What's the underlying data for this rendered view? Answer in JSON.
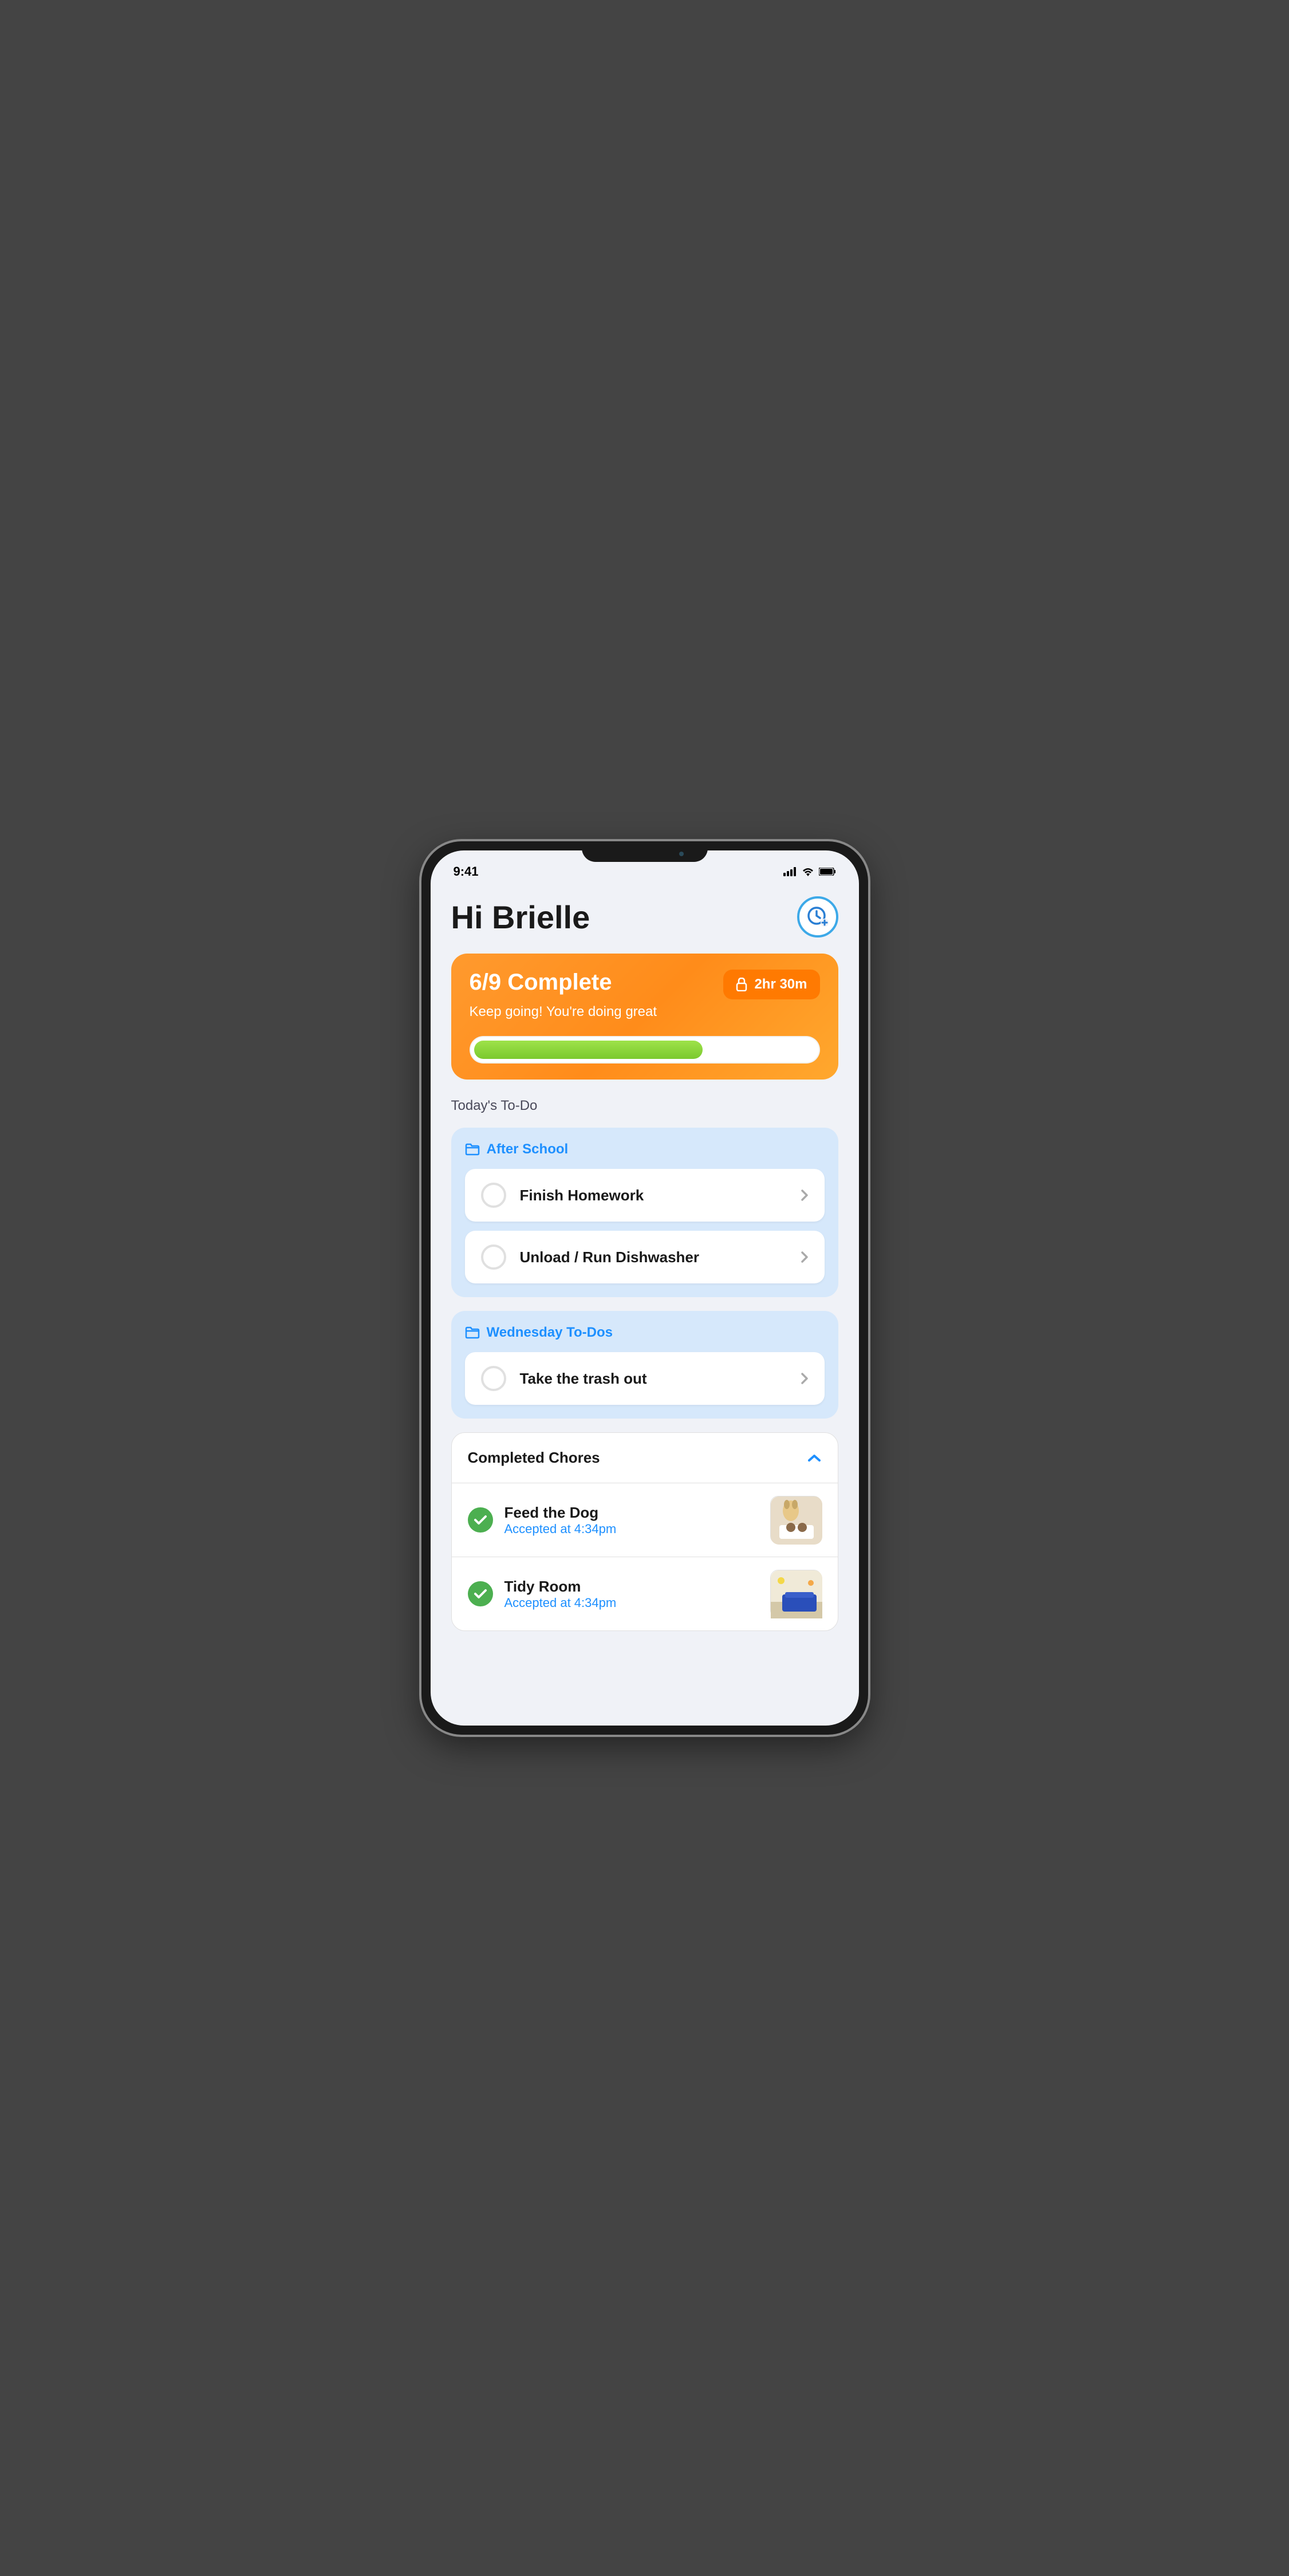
{
  "statusBar": {
    "time": "9:41"
  },
  "header": {
    "greeting": "Hi Brielle"
  },
  "progress": {
    "title": "6/9 Complete",
    "subtitle": "Keep going! You're doing great",
    "lockedTime": "2hr 30m",
    "percent": 67
  },
  "todo": {
    "title": "Today's To-Do",
    "groups": [
      {
        "label": "After School",
        "tasks": [
          "Finish Homework",
          "Unload / Run Dishwasher"
        ]
      },
      {
        "label": "Wednesday To-Dos",
        "tasks": [
          "Take the trash out"
        ]
      }
    ]
  },
  "completed": {
    "title": "Completed Chores",
    "items": [
      {
        "name": "Feed the Dog",
        "status": "Accepted at 4:34pm",
        "thumb": "dog"
      },
      {
        "name": "Tidy Room",
        "status": "Accepted at 4:34pm",
        "thumb": "room"
      }
    ]
  }
}
